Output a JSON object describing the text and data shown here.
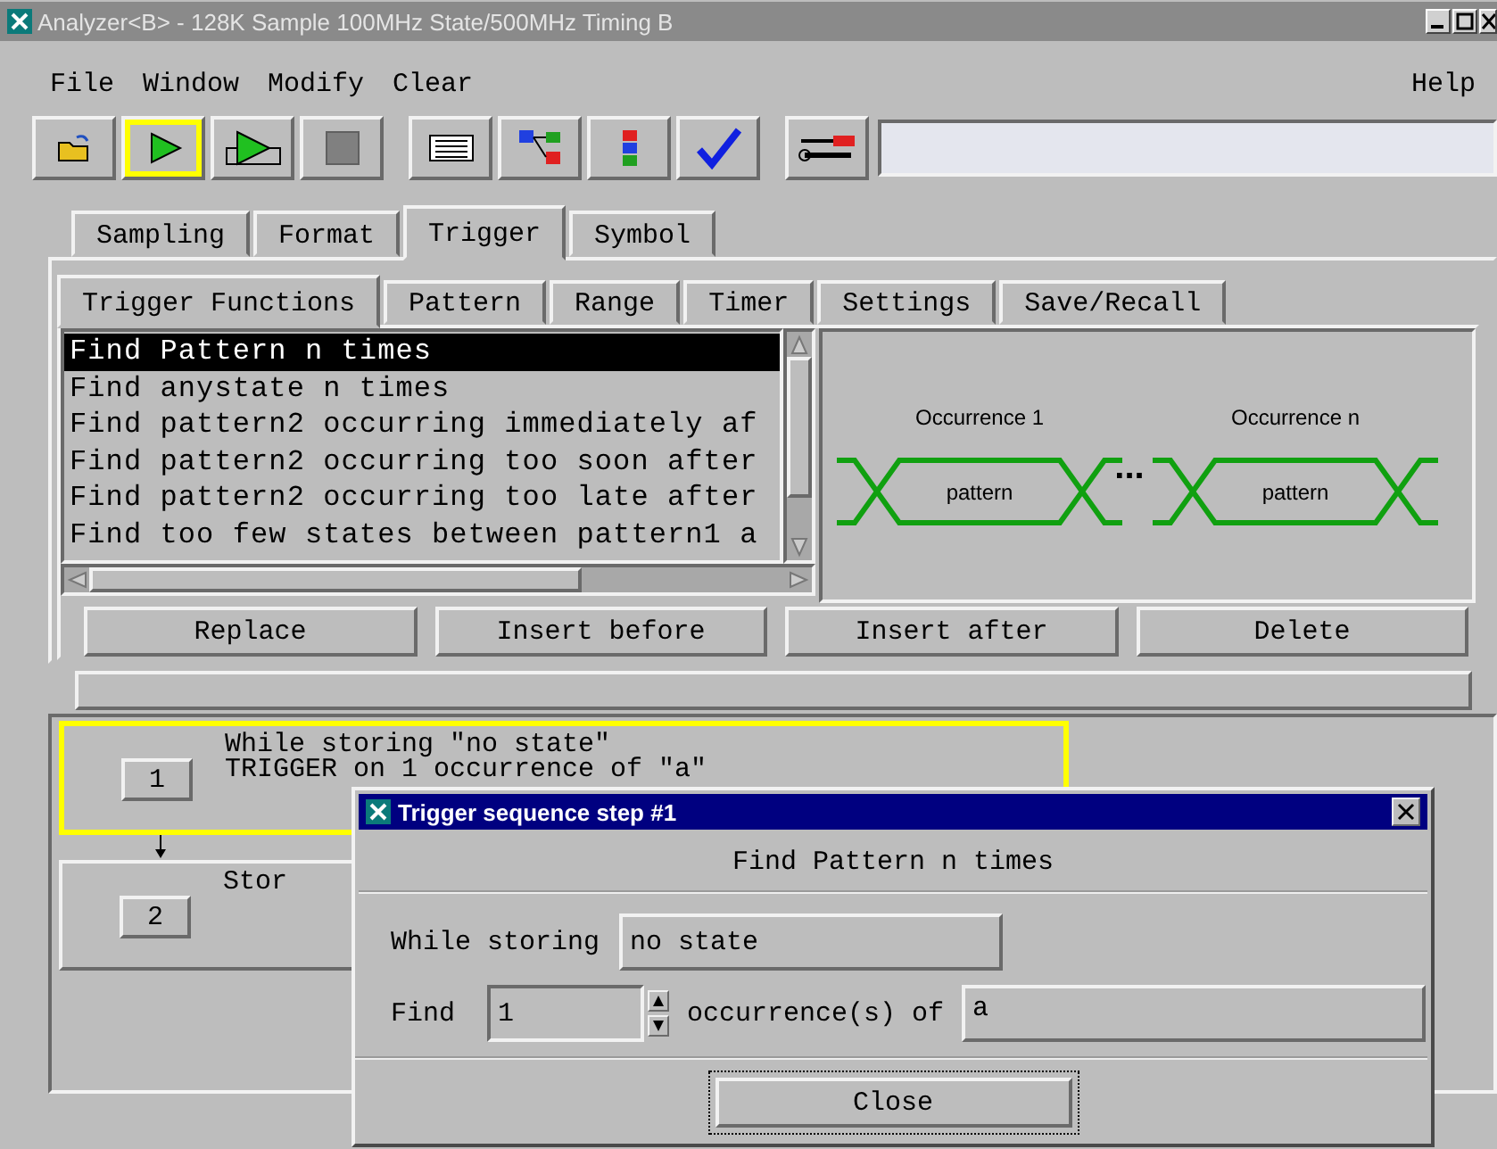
{
  "window": {
    "title": "Analyzer<B> - 128K Sample 100MHz State/500MHz Timing B"
  },
  "menu": {
    "items": [
      "File",
      "Window",
      "Modify",
      "Clear"
    ],
    "help": "Help"
  },
  "toolbar": [
    {
      "selected": false
    },
    {
      "selected": true
    },
    {
      "selected": false
    },
    {
      "selected": false
    },
    {
      "selected": false
    },
    {
      "selected": false
    },
    {
      "selected": false
    },
    {
      "selected": false
    },
    {
      "selected": false
    }
  ],
  "tabs": [
    {
      "label": "Sampling",
      "selected": false
    },
    {
      "label": "Format",
      "selected": false
    },
    {
      "label": "Trigger",
      "selected": true
    },
    {
      "label": "Symbol",
      "selected": false
    }
  ],
  "subtabs": [
    {
      "label": "Trigger Functions",
      "selected": true
    },
    {
      "label": "Pattern",
      "selected": false
    },
    {
      "label": "Range",
      "selected": false
    },
    {
      "label": "Timer",
      "selected": false
    },
    {
      "label": "Settings",
      "selected": false
    },
    {
      "label": "Save/Recall",
      "selected": false
    }
  ],
  "functions": [
    {
      "label": "Find Pattern n times",
      "selected": true
    },
    {
      "label": "Find anystate n times",
      "selected": false
    },
    {
      "label": "Find pattern2 occurring immediately af",
      "selected": false
    },
    {
      "label": "Find pattern2 occurring too soon after",
      "selected": false
    },
    {
      "label": "Find pattern2 occurring too late after",
      "selected": false
    },
    {
      "label": "Find too few states between pattern1 a",
      "selected": false
    }
  ],
  "diagram": {
    "occurrences": [
      {
        "label": "Occurrence 1",
        "pattern": "pattern"
      },
      {
        "label": "Occurrence n",
        "pattern": "pattern"
      }
    ],
    "ellipsis": "..."
  },
  "actions": [
    "Replace",
    "Insert before",
    "Insert after",
    "Delete"
  ],
  "sequence": [
    {
      "number": "1",
      "lines": [
        "While storing \"no state\"",
        "TRIGGER on 1 occurrence of \"a\""
      ],
      "selected": true
    },
    {
      "number": "2",
      "lines": [
        "Stor"
      ],
      "selected": false
    }
  ],
  "dialog": {
    "title": "Trigger sequence step #1",
    "heading": "Find Pattern n times",
    "storing_label": "While storing",
    "storing_value": "no state",
    "find_label": "Find",
    "count": "1",
    "occurrence_label": "occurrence(s) of",
    "pattern_value": "a",
    "close": "Close"
  }
}
